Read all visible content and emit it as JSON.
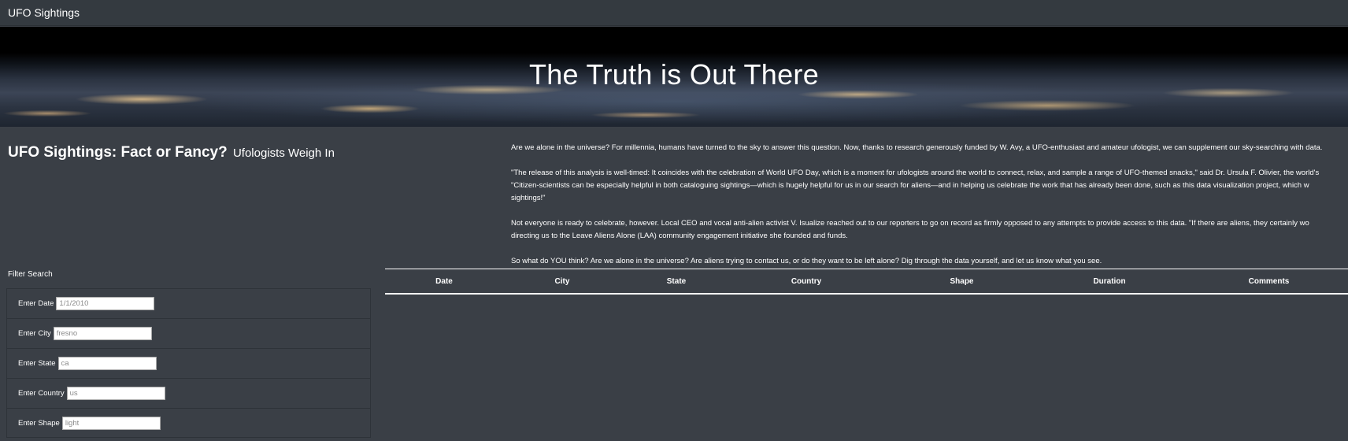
{
  "navbar": {
    "brand": "UFO Sightings"
  },
  "hero": {
    "title": "The Truth is Out There"
  },
  "heading": {
    "title": "UFO Sightings: Fact or Fancy?",
    "subtitle": "Ufologists Weigh In"
  },
  "article": {
    "paragraphs": [
      "Are we alone in the universe? For millennia, humans have turned to the sky to answer this question. Now, thanks to research generously funded by W. Avy, a UFO-enthusiast and amateur ufologist, we can supplement our sky-searching with data.",
      "\"The release of this analysis is well-timed: It coincides with the celebration of World UFO Day, which is a moment for ufologists around the world to connect, relax, and sample a range of UFO-themed snacks,\" said Dr. Ursula F. Olivier, the world's",
      "\"Citizen-scientists can be especially helpful in both cataloguing sightings—which is hugely helpful for us in our search for aliens—and in helping us celebrate the work that has already been done, such as this data visualization project, which w",
      "sightings!\"",
      "Not everyone is ready to celebrate, however. Local CEO and vocal anti-alien activist V. Isualize reached out to our reporters to go on record as firmly opposed to any attempts to provide access to this data. \"If there are aliens, they certainly wo",
      "directing us to the Leave Aliens Alone (LAA) community engagement initiative she founded and funds.",
      "So what do YOU think? Are we alone in the universe? Are aliens trying to contact us, or do they want to be left alone? Dig through the data yourself, and let us know what you see."
    ]
  },
  "filters": {
    "title": "Filter Search",
    "items": [
      {
        "label": "Enter Date",
        "placeholder": "1/1/2010"
      },
      {
        "label": "Enter City",
        "placeholder": "fresno"
      },
      {
        "label": "Enter State",
        "placeholder": "ca"
      },
      {
        "label": "Enter Country",
        "placeholder": "us"
      },
      {
        "label": "Enter Shape",
        "placeholder": "light"
      }
    ]
  },
  "table": {
    "columns": [
      "Date",
      "City",
      "State",
      "Country",
      "Shape",
      "Duration",
      "Comments"
    ]
  }
}
